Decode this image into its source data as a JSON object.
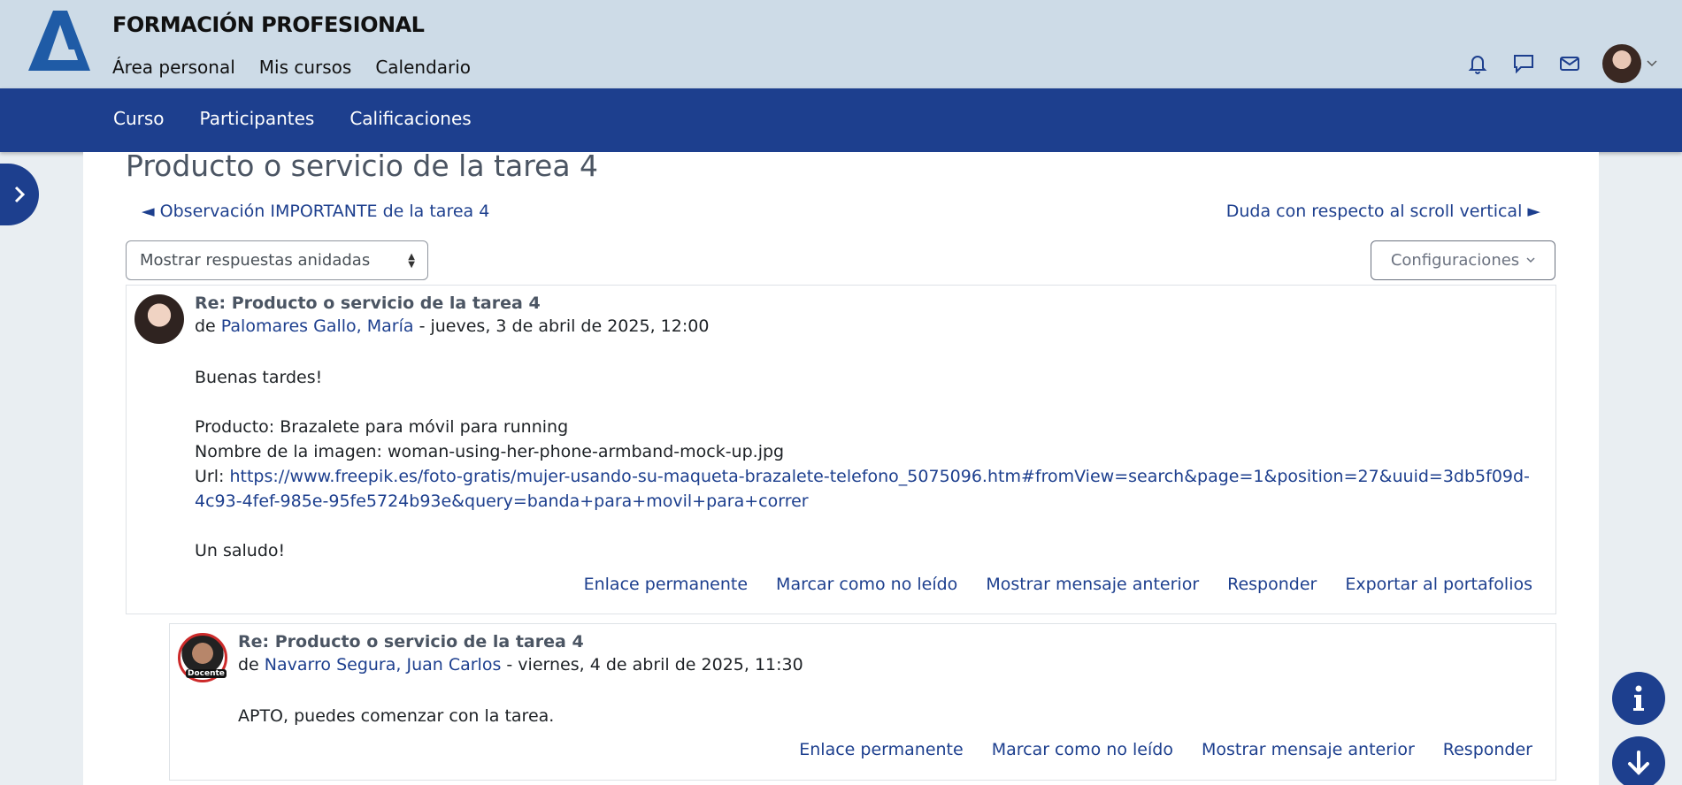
{
  "header": {
    "site_title": "FORMACIÓN PROFESIONAL",
    "nav": [
      "Área personal",
      "Mis cursos",
      "Calendario"
    ]
  },
  "secondary_nav": [
    "Curso",
    "Participantes",
    "Calificaciones"
  ],
  "page": {
    "title": "Producto o servicio de la tarea 4",
    "prev_link": "◄ Observación IMPORTANTE de la tarea 4",
    "next_link": "Duda con respecto al scroll vertical ►",
    "display_mode": "Mostrar respuestas anidadas",
    "settings_label": "Configuraciones"
  },
  "posts": [
    {
      "subject": "Re: Producto o servicio de la tarea 4",
      "by_prefix": "de",
      "author": "Palomares Gallo, María",
      "date": "- jueves, 3 de abril de 2025, 12:00",
      "lines": [
        "Buenas tardes!",
        "Producto: Brazalete para móvil para running",
        "Nombre de la imagen: woman-using-her-phone-armband-mock-up.jpg"
      ],
      "url_label": "Url:",
      "url": "https://www.freepik.es/foto-gratis/mujer-usando-su-maqueta-brazalete-telefono_5075096.htm#fromView=search&page=1&position=27&uuid=3db5f09d-4c93-4fef-985e-95fe5724b93e&query=banda+para+movil+para+correr",
      "closing": "Un saludo!",
      "actions": [
        "Enlace permanente",
        "Marcar como no leído",
        "Mostrar mensaje anterior",
        "Responder",
        "Exportar al portafolios"
      ]
    },
    {
      "subject": "Re: Producto o servicio de la tarea 4",
      "by_prefix": "de",
      "author": "Navarro Segura, Juan Carlos",
      "date": "- viernes, 4 de abril de 2025, 11:30",
      "badge": "Docente",
      "body": "APTO, puedes comenzar con la tarea.",
      "actions": [
        "Enlace permanente",
        "Marcar como no leído",
        "Mostrar mensaje anterior",
        "Responder"
      ]
    }
  ],
  "colors": {
    "header_bg": "#cddbe7",
    "nav_bg": "#1d3f8e",
    "link": "#1d3f8e"
  },
  "icons": [
    "bell-icon",
    "chat-icon",
    "mail-icon",
    "chevron-right-icon",
    "info-icon",
    "arrow-down-icon"
  ]
}
